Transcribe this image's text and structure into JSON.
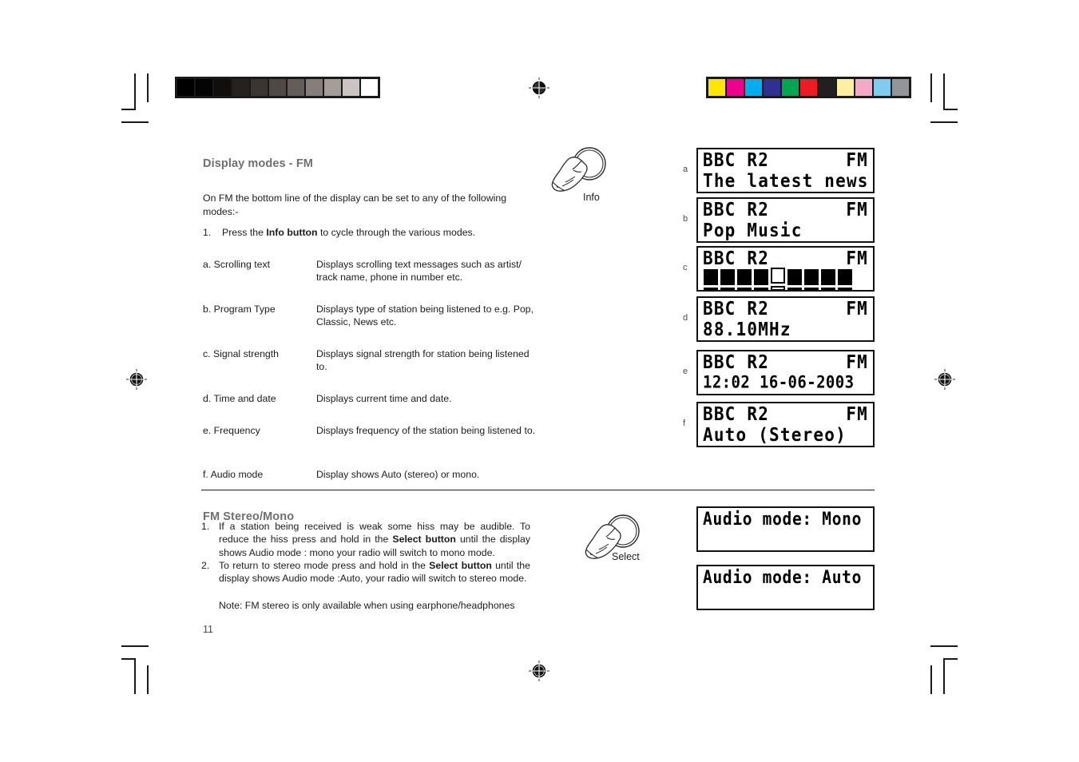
{
  "document": {
    "page_number": "11"
  },
  "print_marks": {
    "grayscale_patches": [
      "#000000",
      "#040404",
      "#120e0c",
      "#26211f",
      "#3b3531",
      "#4f4843",
      "#645c57",
      "#867e79",
      "#a49d98",
      "#c9c4c1",
      "#ffffff"
    ],
    "color_patches": [
      "#ffe600",
      "#ec008c",
      "#00aeef",
      "#2e3192",
      "#00a651",
      "#ed1c24",
      "#231f20",
      "#fdf0a0",
      "#f4a9c7",
      "#7fcdee",
      "#939598"
    ]
  },
  "sections": {
    "display_modes": {
      "heading": "Display modes - FM",
      "intro": "On FM the bottom line of the display can be set to any of the following modes:-",
      "step": {
        "number": "1.",
        "text_before": "Press the ",
        "emphasis": "Info button",
        "text_after": " to cycle through the various modes."
      },
      "modes": [
        {
          "label": "a. Scrolling text",
          "description": "Displays scrolling text messages such as artist/ track name, phone in number etc."
        },
        {
          "label": "b. Program Type",
          "description": "Displays type of station being listened to e.g. Pop, Classic, News etc."
        },
        {
          "label": "c. Signal strength",
          "description": "Displays signal strength for station being listened to."
        },
        {
          "label": "d. Time and date",
          "description": "Displays current time and date."
        },
        {
          "label": "e. Frequency",
          "description": "Displays frequency of the station being listened to."
        },
        {
          "label": "f. Audio mode",
          "description": "Display shows Auto (stereo) or mono."
        }
      ],
      "hand_figure_caption": "Info"
    },
    "fm_stereo_mono": {
      "heading": "FM Stereo/Mono",
      "items": [
        {
          "number": "1.",
          "text_before": "If a station being received is weak some hiss may be audible. To reduce the hiss press and hold in the ",
          "emphasis": "Select button",
          "text_after": " until the display shows Audio mode : mono your radio will  switch to mono mode."
        },
        {
          "number": "2.",
          "text_before": "To return to stereo mode press and  hold in the ",
          "emphasis": "Select button",
          "text_after": " until the display shows Audio mode :Auto, your radio will  switch  to stereo mode."
        }
      ],
      "note": "Note: FM stereo is only available when using earphone/headphones",
      "hand_figure_caption": "Select"
    }
  },
  "lcd_displays": {
    "fm_modes": [
      {
        "key": "a",
        "line1_left": "BBC R2",
        "line1_right": "FM",
        "line2": "The latest news",
        "type": "text"
      },
      {
        "key": "b",
        "line1_left": "BBC R2",
        "line1_right": "FM",
        "line2": "Pop Music",
        "type": "text"
      },
      {
        "key": "c",
        "line1_left": "BBC R2",
        "line1_right": "FM",
        "line2": "",
        "type": "bars",
        "bar_total": 9,
        "bar_filled": 4,
        "bar_hollow_index": 5
      },
      {
        "key": "d",
        "line1_left": "BBC R2",
        "line1_right": "FM",
        "line2": "88.10MHz",
        "type": "text"
      },
      {
        "key": "e",
        "line1_left": "BBC R2",
        "line1_right": "FM",
        "line2": "12:02 16-06-2003",
        "type": "text"
      },
      {
        "key": "f",
        "line1_left": "BBC R2",
        "line1_right": "FM",
        "line2": "Auto (Stereo)",
        "type": "text"
      }
    ],
    "audio_modes": [
      {
        "line1": "Audio mode: Mono",
        "line2": ""
      },
      {
        "line1": "Audio mode: Auto",
        "line2": ""
      }
    ]
  }
}
